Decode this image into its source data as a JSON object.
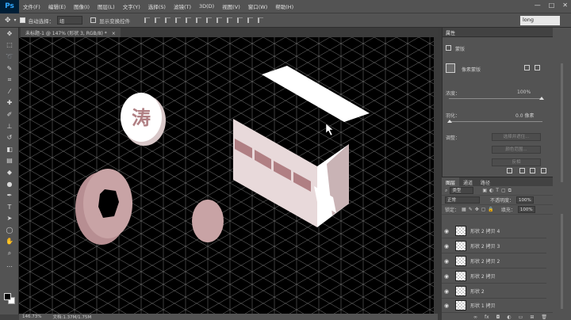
{
  "app": {
    "logo": "Ps"
  },
  "menu": [
    "文件(F)",
    "编辑(E)",
    "图像(I)",
    "图层(L)",
    "文字(Y)",
    "选择(S)",
    "滤镜(T)",
    "3D(D)",
    "视图(V)",
    "窗口(W)",
    "帮助(H)"
  ],
  "window_controls": [
    "—",
    "□",
    "✕"
  ],
  "options": {
    "auto_select_label": "自动选择：",
    "auto_select_value": "组",
    "show_transform_label": "显示变换控件",
    "long_value": "long"
  },
  "document": {
    "tab_title": "未标题-1 @ 147% (形状 3, RGB/8) *",
    "close": "×"
  },
  "status": {
    "zoom": "146.73%",
    "doc_info": "文档:1.37M/1.75M"
  },
  "canvas_text": {
    "badge_char": "涛"
  },
  "properties": {
    "header": "属性",
    "mode_label": "蒙版",
    "pixel_mask_label": "像素蒙版",
    "density_label": "浓度：",
    "density_value": "100%",
    "feather_label": "羽化：",
    "feather_value": "0.0 像素",
    "adjust_label": "调整：",
    "btn_select_mask": "选择并遮住...",
    "btn_color_range": "颜色范围...",
    "btn_invert": "反相"
  },
  "layers": {
    "tabs": [
      "图层",
      "通道",
      "路径"
    ],
    "search_value": "类型",
    "blend_mode": "正常",
    "opacity_label": "不透明度：",
    "opacity_value": "100%",
    "lock_label": "锁定：",
    "fill_label": "填充：",
    "fill_value": "100%",
    "rows": [
      {
        "name": "形状 2 拷贝 4"
      },
      {
        "name": "形状 2 拷贝 3"
      },
      {
        "name": "形状 2 拷贝 2"
      },
      {
        "name": "形状 2 拷贝"
      },
      {
        "name": "形状 2"
      },
      {
        "name": "形状 1 拷贝"
      }
    ]
  },
  "colors": {
    "canvas_bg": "#000000",
    "shape_pink": "#c8a3a5",
    "shape_dark": "#b07f83",
    "shape_light": "#e8d9da",
    "shape_white": "#ffffff"
  }
}
